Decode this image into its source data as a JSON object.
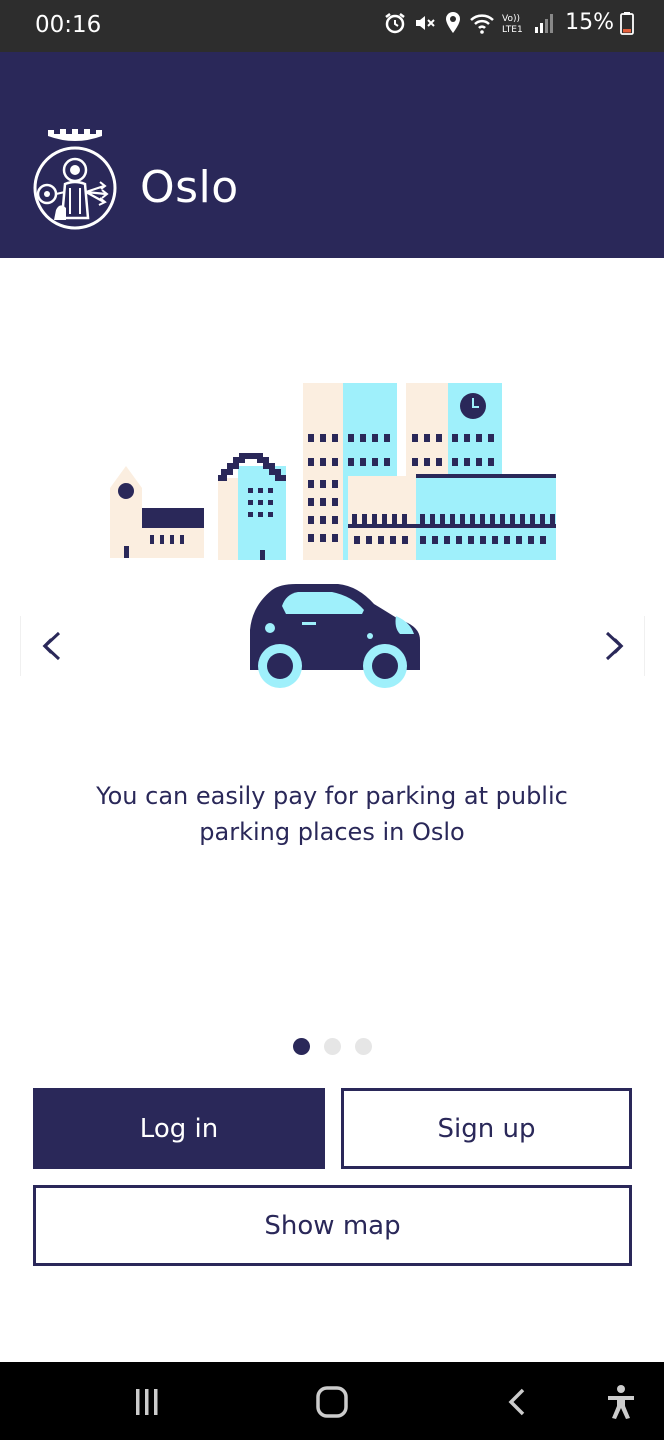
{
  "status_bar": {
    "time": "00:16",
    "battery_percent": "15%",
    "icons": [
      "alarm-icon",
      "mute-icon",
      "location-icon",
      "wifi-icon",
      "volte-icon",
      "signal-icon",
      "battery-icon"
    ],
    "volte_label_top": "Vo))",
    "volte_label_bottom": "LTE1"
  },
  "header": {
    "title": "Oslo",
    "logo": "oslo-coat-of-arms",
    "background": "#2a2859"
  },
  "carousel": {
    "caption": "You can easily pay for parking at public parking places in Oslo",
    "current_page": 1,
    "total_pages": 3,
    "prev_icon": "chevron-left-icon",
    "next_icon": "chevron-right-icon"
  },
  "actions": {
    "login_label": "Log in",
    "signup_label": "Sign up",
    "map_label": "Show map"
  },
  "system_nav": {
    "items": [
      "recent-apps-icon",
      "home-icon",
      "back-icon",
      "accessibility-icon"
    ]
  },
  "colors": {
    "primary": "#2a2859",
    "accent_light_blue": "#9ff0fb",
    "accent_beige": "#fbeee0"
  }
}
